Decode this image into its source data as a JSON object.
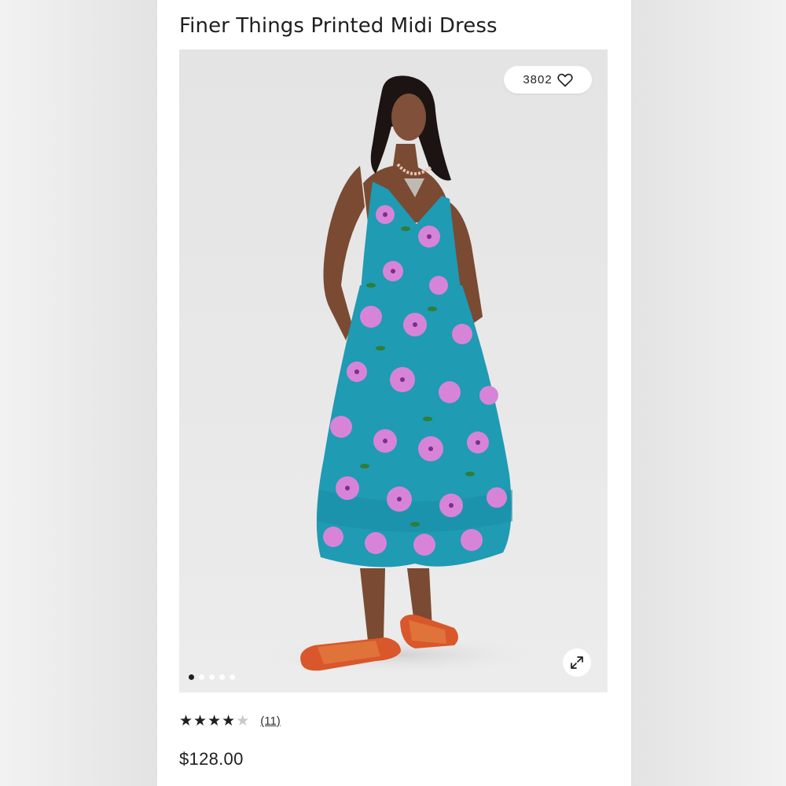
{
  "product": {
    "title": "Finer Things Printed Midi Dress",
    "price": "$128.00",
    "likes": "3802",
    "rating": 4,
    "rating_max": 5,
    "review_count": "(11)"
  },
  "gallery": {
    "image_count": 5,
    "active_index": 0,
    "image_alt": "Model wearing a turquoise dress with pink and purple floral print and orange woven slide sandals"
  },
  "icons": {
    "like": "heart-icon",
    "expand": "expand-icon",
    "star": "star-icon"
  },
  "colors": {
    "dress": "#1f9bb3",
    "flower": "#d784d8",
    "sandal": "#d9572a",
    "text": "#1f1f1f"
  }
}
